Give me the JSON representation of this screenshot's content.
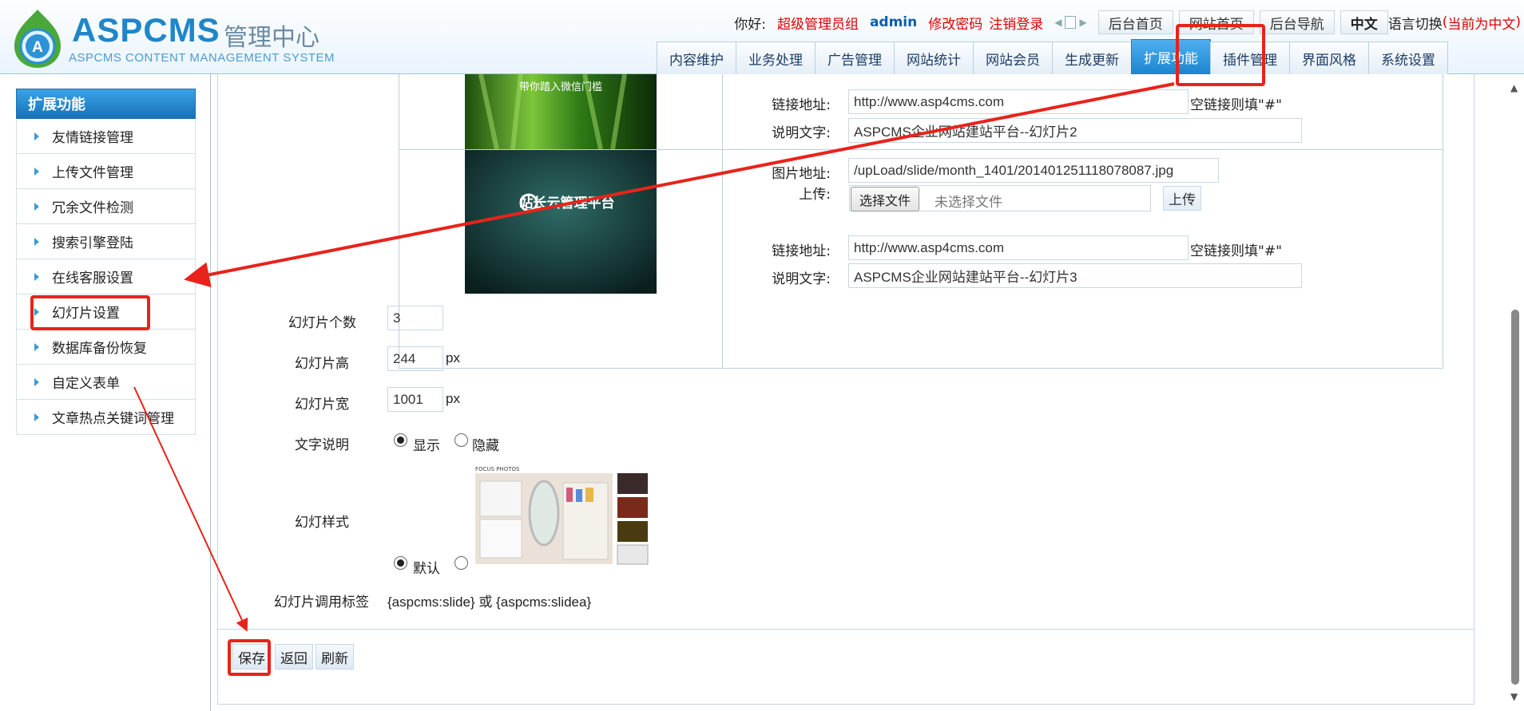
{
  "header": {
    "brand": "ASPCMS",
    "brand_cn": "管理中心",
    "brand_sub": "ASPCMS CONTENT MANAGEMENT SYSTEM",
    "greeting": "你好:",
    "role": "超级管理员组",
    "user": "admin",
    "change_password": "修改密码",
    "logout": "注销登录",
    "buttons": [
      "后台首页",
      "网站首页",
      "后台导航",
      "中文"
    ],
    "lang_switch": "语言切换",
    "lang_paren_open": "(",
    "current_lang": "当前为中文",
    "lang_paren_close": ")"
  },
  "nav": {
    "tabs": [
      "内容维护",
      "业务处理",
      "广告管理",
      "网站统计",
      "网站会员",
      "生成更新",
      "扩展功能",
      "插件管理",
      "界面风格",
      "系统设置"
    ],
    "active": "扩展功能"
  },
  "sidebar": {
    "title": "扩展功能",
    "items": [
      "友情链接管理",
      "上传文件管理",
      "冗余文件检测",
      "搜索引擎登陆",
      "在线客服设置",
      "幻灯片设置",
      "数据库备份恢复",
      "自定义表单",
      "文章热点关键词管理"
    ]
  },
  "slides": {
    "slide2": {
      "link_label": "链接地址:",
      "link_value": "http://www.asp4cms.com",
      "link_hint": "空链接则填\"#\"",
      "desc_label": "说明文字:",
      "desc_value": "ASPCMS企业网站建站平台--幻灯片2",
      "thumb_text": "带你踏入微信门槛"
    },
    "slide3": {
      "img_label": "图片地址:",
      "img_value": "/upLoad/slide/month_1401/201401251118078087.jpg",
      "upload_label": "上传:",
      "choose_file": "选择文件",
      "no_file": "未选择文件",
      "upload_btn": "上传",
      "link_label": "链接地址:",
      "link_value": "http://www.asp4cms.com",
      "link_hint": "空链接则填\"#\"",
      "desc_label": "说明文字:",
      "desc_value": "ASPCMS企业网站建站平台--幻灯片3",
      "thumb_text": "站长云管理平台"
    }
  },
  "settings": {
    "count_label": "幻灯片个数",
    "count_value": "3",
    "height_label": "幻灯片高",
    "height_value": "244",
    "width_label": "幻灯片宽",
    "width_value": "1001",
    "unit": "px",
    "text_label": "文字说明",
    "show": "显示",
    "hide": "隐藏",
    "style_label": "幻灯样式",
    "style_default": "默认",
    "style_preview_caption": "FOCUS PHOTOS",
    "tag_label": "幻灯片调用标签",
    "tag_value": "{aspcms:slide} 或 {aspcms:slidea}"
  },
  "actions": [
    "保存",
    "返回",
    "刷新"
  ],
  "colors": {
    "accent": "#1f86c8",
    "annotation": "#e8231b",
    "active_tab": "#1b84d0"
  }
}
